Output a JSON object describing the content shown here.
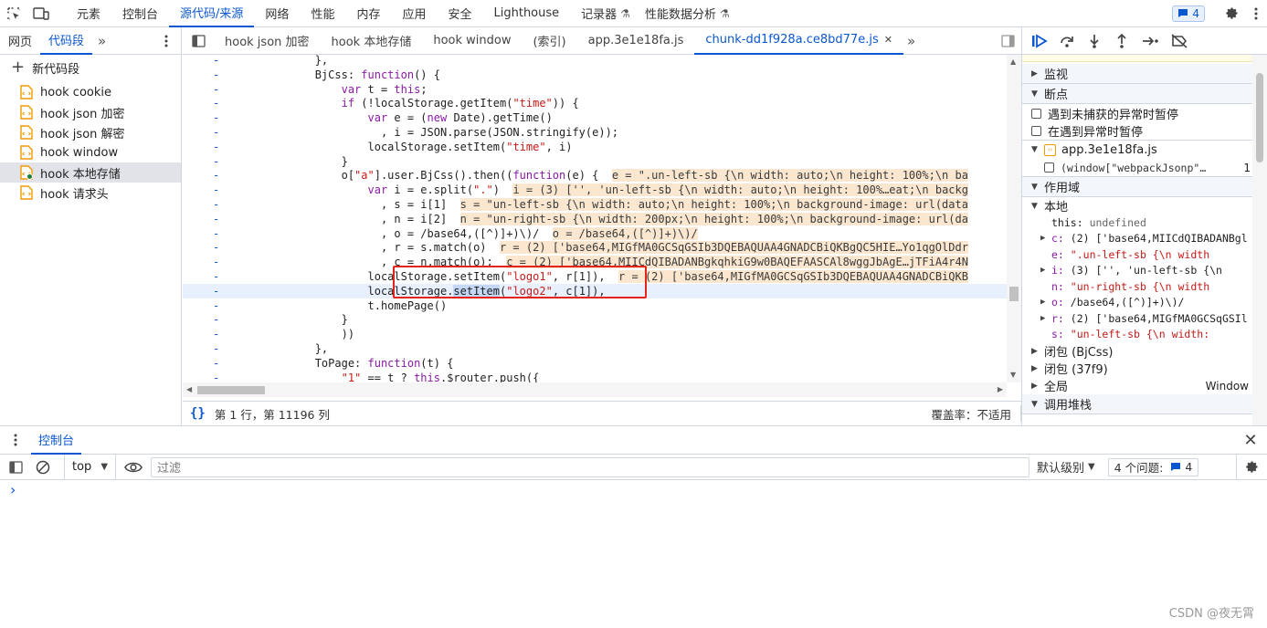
{
  "top_tabs": [
    "元素",
    "控制台",
    "源代码/来源",
    "网络",
    "性能",
    "内存",
    "应用",
    "安全",
    "Lighthouse",
    "记录器",
    "性能数据分析"
  ],
  "top_active_tab": "源代码/来源",
  "issues_badge_count": "4",
  "left": {
    "tabs": [
      "网页",
      "代码段"
    ],
    "new_snippet": "新代码段",
    "snippets": [
      "hook cookie",
      "hook json 加密",
      "hook json 解密",
      "hook window",
      "hook 本地存储",
      "hook 请求头"
    ],
    "selected_snippet": "hook 本地存储"
  },
  "editor": {
    "tabs": [
      "hook json 加密",
      "hook 本地存储",
      "hook window",
      "(索引)",
      "app.3e1e18fa.js",
      "chunk-dd1f928a.ce8bd77e.js"
    ],
    "active_tab": "chunk-dd1f928a.ce8bd77e.js",
    "gutter_marker": "-",
    "code_lines": [
      [
        "            },",
        ""
      ],
      [
        "            BjCss: function() {",
        ""
      ],
      [
        "                var t = this;",
        ""
      ],
      [
        "                if (!localStorage.getItem(\"time\")) {",
        ""
      ],
      [
        "                    var e = (new Date).getTime()",
        ""
      ],
      [
        "                      , i = JSON.parse(JSON.stringify(e));",
        ""
      ],
      [
        "                    localStorage.setItem(\"time\", i)",
        ""
      ],
      [
        "                }",
        ""
      ],
      [
        "                o[\"a\"].user.BjCss().then((function(e) {",
        "e = \".un-left-sb {\\n width: auto;\\n height: 100%;\\n ba"
      ],
      [
        "                    var i = e.split(\".\")",
        "i = (3) ['', 'un-left-sb {\\n width: auto;\\n height: 100%…eat;\\n backg"
      ],
      [
        "                      , s = i[1]",
        "s = \"un-left-sb {\\n width: auto;\\n height: 100%;\\n background-image: url(data"
      ],
      [
        "                      , n = i[2]",
        "n = \"un-right-sb {\\n width: 200px;\\n height: 100%;\\n background-image: url(da"
      ],
      [
        "                      , o = /base64,([^)]+)\\)/",
        "o = /base64,([^)]+)\\)/"
      ],
      [
        "                      , r = s.match(o)",
        "r = (2) ['base64,MIGfMA0GCSqGSIb3DQEBAQUAA4GNADCBiQKBgQC5HIE…Yo1qgOlDdr"
      ],
      [
        "                      , c = n.match(o);",
        "c = (2) ['base64,MIICdQIBADANBgkqhkiG9w0BAQEFAASCAl8wggJbAgE…jTFiA4r4N"
      ],
      [
        "                    localStorage.setItem(\"logo1\", r[1]),",
        "r = (2) ['base64,MIGfMA0GCSqGSIb3DQEBAQUAA4GNADCBiQKB"
      ],
      [
        "                    localStorage.setItem(\"logo2\", c[1]),",
        ""
      ],
      [
        "                    t.homePage()",
        ""
      ],
      [
        "                }",
        ""
      ],
      [
        "                ))",
        ""
      ],
      [
        "            },",
        ""
      ],
      [
        "            ToPage: function(t) {",
        ""
      ],
      [
        "                \"1\" == t ? this.$router.push({",
        ""
      ]
    ],
    "status_position": "第 1 行，第 11196 列",
    "status_coverage": "覆盖率：不适用"
  },
  "debugger": {
    "watch": "监视",
    "breakpoints": "断点",
    "pause_uncaught": "遇到未捕获的异常时暂停",
    "pause_caught": "在遇到异常时暂停",
    "bp_file": "app.3e1e18fa.js",
    "bp_code": "(window[\"webpackJsonp\"…",
    "bp_line": "1",
    "scope": "作用域",
    "local": "本地",
    "scope_vars": [
      [
        "",
        "this",
        "undefined"
      ],
      [
        "▶",
        "c",
        "(2) ['base64,MIICdQIBADANBgl"
      ],
      [
        "",
        "e",
        "\".un-left-sb {\\n      width"
      ],
      [
        "▶",
        "i",
        "(3) ['', 'un-left-sb {\\n"
      ],
      [
        "",
        "n",
        "\"un-right-sb {\\n      width"
      ],
      [
        "▶",
        "o",
        "/base64,([^)]+)\\)/"
      ],
      [
        "▶",
        "r",
        "(2) ['base64,MIGfMA0GCSqGSIl"
      ],
      [
        "",
        "s",
        "\"un-left-sb {\\n      width:"
      ]
    ],
    "closure1": "闭包 (BjCss)",
    "closure2": "闭包 (37f9)",
    "global": "全局",
    "global_value": "Window",
    "callstack": "调用堆栈"
  },
  "console": {
    "tab": "控制台",
    "context": "top",
    "filter_placeholder": "过滤",
    "level": "默认级别",
    "issues_label": "4 个问题:",
    "issues_count": "4",
    "prompt": "›"
  },
  "watermark": "CSDN @夜无霄"
}
